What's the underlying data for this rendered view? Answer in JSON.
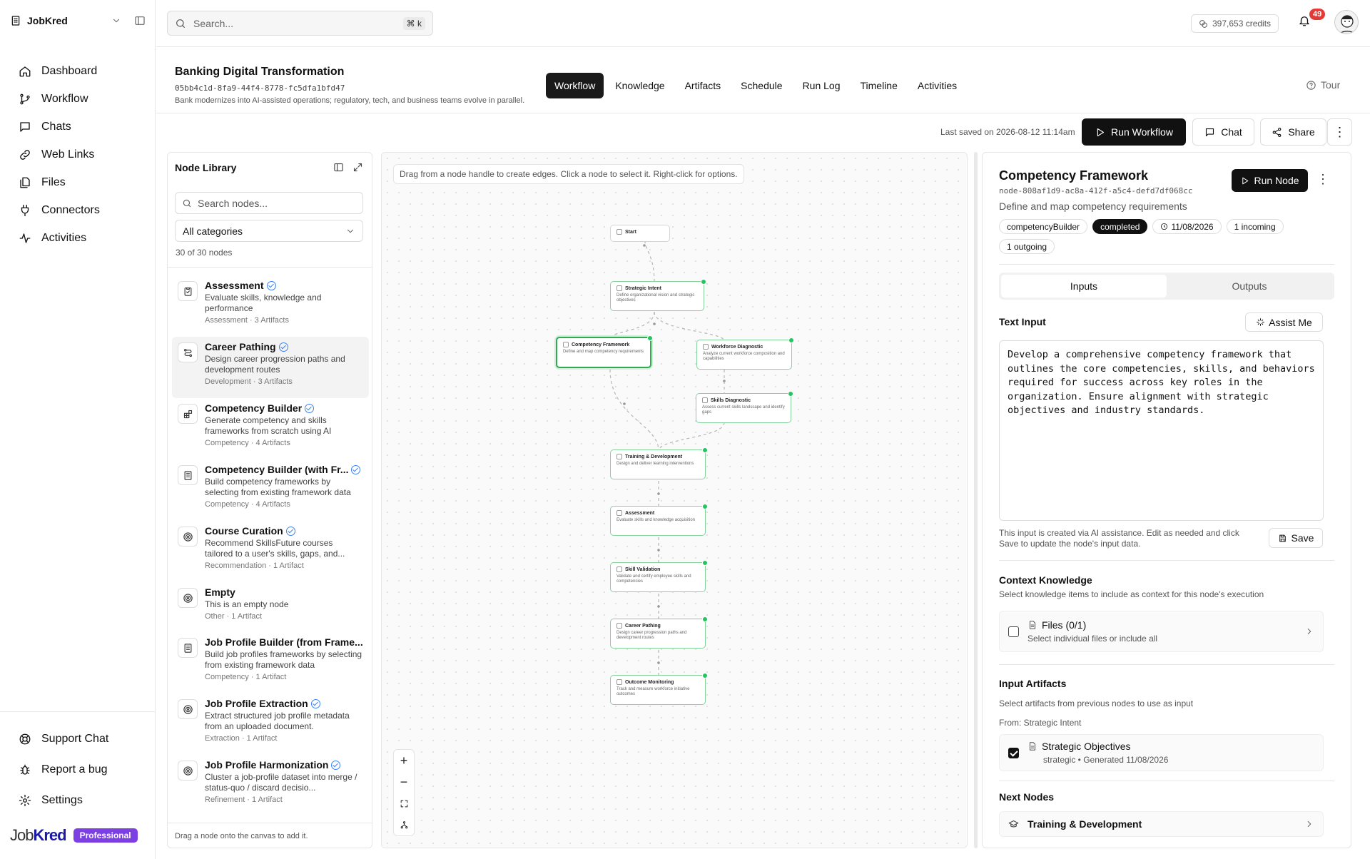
{
  "workspace": {
    "name": "JobKred"
  },
  "nav": {
    "items": [
      {
        "label": "Dashboard",
        "icon": "home-icon"
      },
      {
        "label": "Workflow",
        "icon": "workflow-icon"
      },
      {
        "label": "Chats",
        "icon": "chat-icon"
      },
      {
        "label": "Web Links",
        "icon": "link-icon"
      },
      {
        "label": "Files",
        "icon": "files-icon"
      },
      {
        "label": "Connectors",
        "icon": "plug-icon"
      },
      {
        "label": "Activities",
        "icon": "activity-icon"
      }
    ],
    "bottom": [
      {
        "label": "Support Chat",
        "icon": "support-icon"
      },
      {
        "label": "Report a bug",
        "icon": "bug-icon"
      },
      {
        "label": "Settings",
        "icon": "gear-icon"
      }
    ]
  },
  "brand": {
    "logo_a": "Job",
    "logo_b": "Kred",
    "plan": "Professional"
  },
  "search": {
    "placeholder": "Search...",
    "shortcut": "⌘ k"
  },
  "topbar": {
    "credits": "397,653 credits",
    "notifications": "49"
  },
  "project": {
    "title": "Banking Digital Transformation",
    "id": "05bb4c1d-8fa9-44f4-8778-fc5dfa1bfd47",
    "description": "Bank modernizes into AI-assisted operations; regulatory, tech, and business teams evolve in parallel."
  },
  "tabs": [
    "Workflow",
    "Knowledge",
    "Artifacts",
    "Schedule",
    "Run Log",
    "Timeline",
    "Activities"
  ],
  "tour": "Tour",
  "toolbar": {
    "last_saved": "Last saved on 2026-08-12 11:14am",
    "run_workflow": "Run Workflow",
    "chat": "Chat",
    "share": "Share"
  },
  "library": {
    "title": "Node Library",
    "search_placeholder": "Search nodes...",
    "category": "All categories",
    "count": "30 of 30 nodes",
    "footer": "Drag a node onto the canvas to add it.",
    "items": [
      {
        "name": "Assessment",
        "desc": "Evaluate skills, knowledge and performance",
        "meta": "Assessment · 3 Artifacts",
        "icon": "clipboard-icon"
      },
      {
        "name": "Career Pathing",
        "desc": "Design career progression paths and development routes",
        "meta": "Development · 3 Artifacts",
        "icon": "route-icon"
      },
      {
        "name": "Competency Builder",
        "desc": "Generate competency and skills frameworks from scratch using AI",
        "meta": "Competency · 4 Artifacts",
        "icon": "blocks-icon"
      },
      {
        "name": "Competency Builder (with Fr...",
        "desc": "Build competency frameworks by selecting from existing framework data",
        "meta": "Competency · 4 Artifacts",
        "icon": "building-icon"
      },
      {
        "name": "Course Curation",
        "desc": "Recommend SkillsFuture courses tailored to a user's skills, gaps, and...",
        "meta": "Recommendation · 1 Artifact",
        "icon": "target-icon"
      },
      {
        "name": "Empty",
        "desc": "This is an empty node",
        "meta": "Other · 1 Artifact",
        "icon": "target-icon"
      },
      {
        "name": "Job Profile Builder (from Frame...",
        "desc": "Build job profiles frameworks by selecting from existing framework data",
        "meta": "Competency · 1 Artifact",
        "icon": "building-icon"
      },
      {
        "name": "Job Profile Extraction",
        "desc": "Extract structured job profile metadata from an uploaded document.",
        "meta": "Extraction · 1 Artifact",
        "icon": "target-icon"
      },
      {
        "name": "Job Profile Harmonization",
        "desc": "Cluster a job-profile dataset into merge / status-quo / discard decisio...",
        "meta": "Refinement · 1 Artifact",
        "icon": "target-icon"
      }
    ]
  },
  "canvas": {
    "hint": "Drag from a node handle to create edges. Click a node to select it. Right-click for options.",
    "nodes": [
      {
        "title": "Start",
        "desc": ""
      },
      {
        "title": "Strategic Intent",
        "desc": "Define organizational vision and strategic objectives"
      },
      {
        "title": "Competency Framework",
        "desc": "Define and map competency requirements"
      },
      {
        "title": "Workforce Diagnostic",
        "desc": "Analyze current workforce composition and capabilities"
      },
      {
        "title": "Skills Diagnostic",
        "desc": "Assess current skills landscape and identify gaps"
      },
      {
        "title": "Training & Development",
        "desc": "Design and deliver learning interventions"
      },
      {
        "title": "Assessment",
        "desc": "Evaluate skills and knowledge acquisition"
      },
      {
        "title": "Skill Validation",
        "desc": "Validate and certify employee skills and competencies"
      },
      {
        "title": "Career Pathing",
        "desc": "Design career progression paths and development routes"
      },
      {
        "title": "Outcome Monitoring",
        "desc": "Track and measure workforce initiative outcomes"
      }
    ]
  },
  "panel": {
    "title": "Competency Framework",
    "id": "node-808af1d9-ac8a-412f-a5c4-defd7df068cc",
    "desc": "Define and map competency requirements",
    "run_node": "Run Node",
    "chips": {
      "builder": "competencyBuilder",
      "status": "completed",
      "date": "11/08/2026",
      "incoming": "1 incoming",
      "outgoing": "1 outgoing"
    },
    "tab_inputs": "Inputs",
    "tab_outputs": "Outputs",
    "text_input_label": "Text Input",
    "assist": "Assist Me",
    "text_input_value": "Develop a comprehensive competency framework that outlines the core competencies, skills, and behaviors required for success across key roles in the organization. Ensure alignment with strategic objectives and industry standards.",
    "input_note": "This input is created via AI assistance. Edit as needed and click Save to update the node's input data.",
    "save": "Save",
    "context_label": "Context Knowledge",
    "context_sub": "Select knowledge items to include as context for this node's execution",
    "files_title": "Files (0/1)",
    "files_sub": "Select individual files or include all",
    "artifacts_label": "Input Artifacts",
    "artifacts_sub": "Select artifacts from previous nodes to use as input",
    "from": "From: Strategic Intent",
    "artifact_title": "Strategic Objectives",
    "artifact_sub": "strategic • Generated 11/08/2026",
    "next_label": "Next Nodes",
    "next_node": "Training & Development"
  }
}
